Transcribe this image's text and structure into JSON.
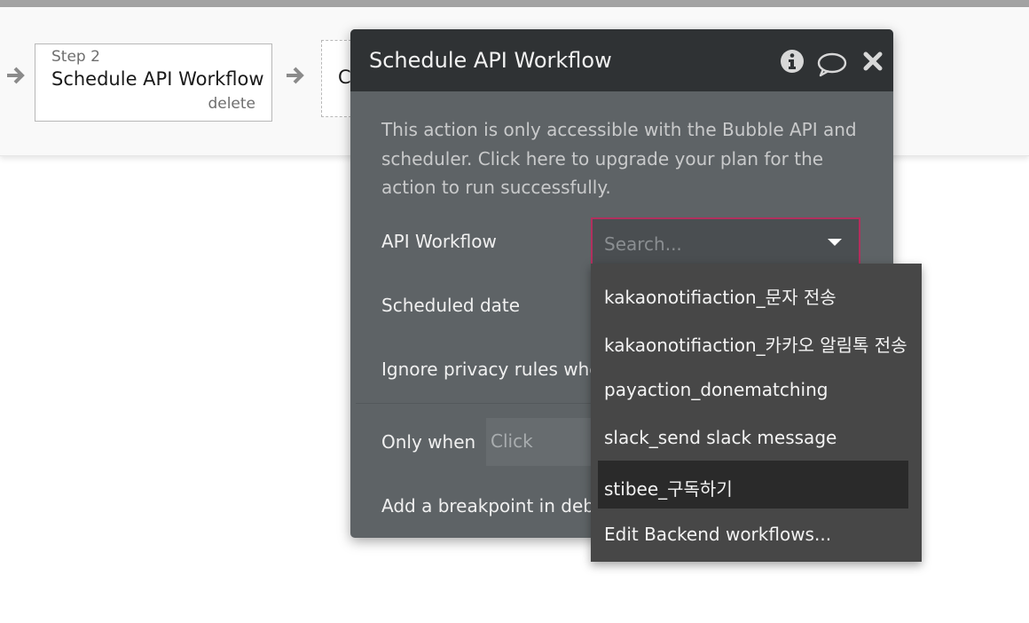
{
  "flow": {
    "step_label": "Step 2",
    "step_title": "Schedule API Workflow",
    "step_delete": "delete",
    "next_card_partial": "C"
  },
  "panel": {
    "title": "Schedule API Workflow",
    "icons": [
      "info-icon",
      "comment-icon",
      "close-icon"
    ],
    "notice": "This action is only accessible with the Bubble API and scheduler. Click here to upgrade your plan for the action to run successfully.",
    "rows": {
      "api_workflow": "API Workflow",
      "scheduled_date": "Scheduled date",
      "ignore_privacy": "Ignore privacy rules whe",
      "only_when": "Only when",
      "breakpoint": "Add a breakpoint in deb"
    },
    "click_placeholder": "Click",
    "search_placeholder": "Search..."
  },
  "dropdown": {
    "items": [
      "kakaonotifiaction_문자 전송",
      "kakaonotifiaction_카카오 알림톡 전송",
      "payaction_donematching",
      "slack_send slack message",
      "stibee_구독하기",
      "Edit Backend workflows..."
    ],
    "highlighted": "stibee_구독하기"
  },
  "colors": {
    "panel_bg": "#5e6366",
    "header_bg": "#2f3234",
    "dropdown_bg": "#474747",
    "focus_border": "#b1305e"
  }
}
